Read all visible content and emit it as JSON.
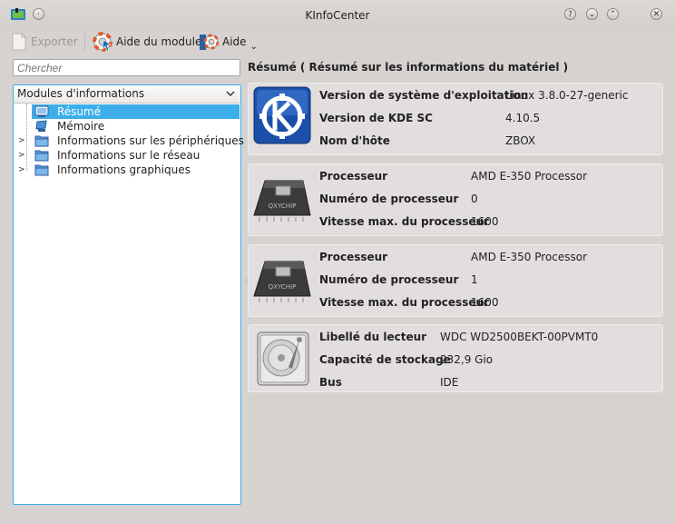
{
  "window": {
    "title": "KInfoCenter"
  },
  "toolbar": {
    "exporter": "Exporter",
    "aide_module": "Aide du module",
    "aide": "Aide"
  },
  "search": {
    "placeholder": "Chercher"
  },
  "tree": {
    "header": "Modules d'informations",
    "items": [
      {
        "label": "Résumé",
        "selected": true,
        "expandable": false
      },
      {
        "label": "Mémoire",
        "selected": false,
        "expandable": false
      },
      {
        "label": "Informations sur les périphériques",
        "selected": false,
        "expandable": true
      },
      {
        "label": "Informations sur le réseau",
        "selected": false,
        "expandable": true
      },
      {
        "label": "Informations graphiques",
        "selected": false,
        "expandable": true
      }
    ]
  },
  "main": {
    "title": "Résumé  ( Résumé sur les informations du matériel )",
    "os": [
      {
        "label": "Version de système d'exploitation",
        "value": "Linux 3.8.0-27-generic"
      },
      {
        "label": "Version de KDE SC",
        "value": "4.10.5"
      },
      {
        "label": "Nom d'hôte",
        "value": "ZBOX"
      }
    ],
    "cpu1": [
      {
        "label": "Processeur",
        "value": "AMD E-350 Processor"
      },
      {
        "label": "Numéro de processeur",
        "value": "0"
      },
      {
        "label": "Vitesse max. du processeur",
        "value": "1600"
      }
    ],
    "cpu2": [
      {
        "label": "Processeur",
        "value": "AMD E-350 Processor"
      },
      {
        "label": "Numéro de processeur",
        "value": "1"
      },
      {
        "label": "Vitesse max. du processeur",
        "value": "1600"
      }
    ],
    "disk": [
      {
        "label": "Libellé du lecteur",
        "value": "WDC WD2500BEKT-00PVMT0"
      },
      {
        "label": "Capacité de stockage",
        "value": "232,9 Gio"
      },
      {
        "label": "Bus",
        "value": "IDE"
      }
    ],
    "chip_brand": "QXYCHIP"
  },
  "colors": {
    "selection": "#3daee9",
    "window_bg": "#d6d2d0"
  }
}
